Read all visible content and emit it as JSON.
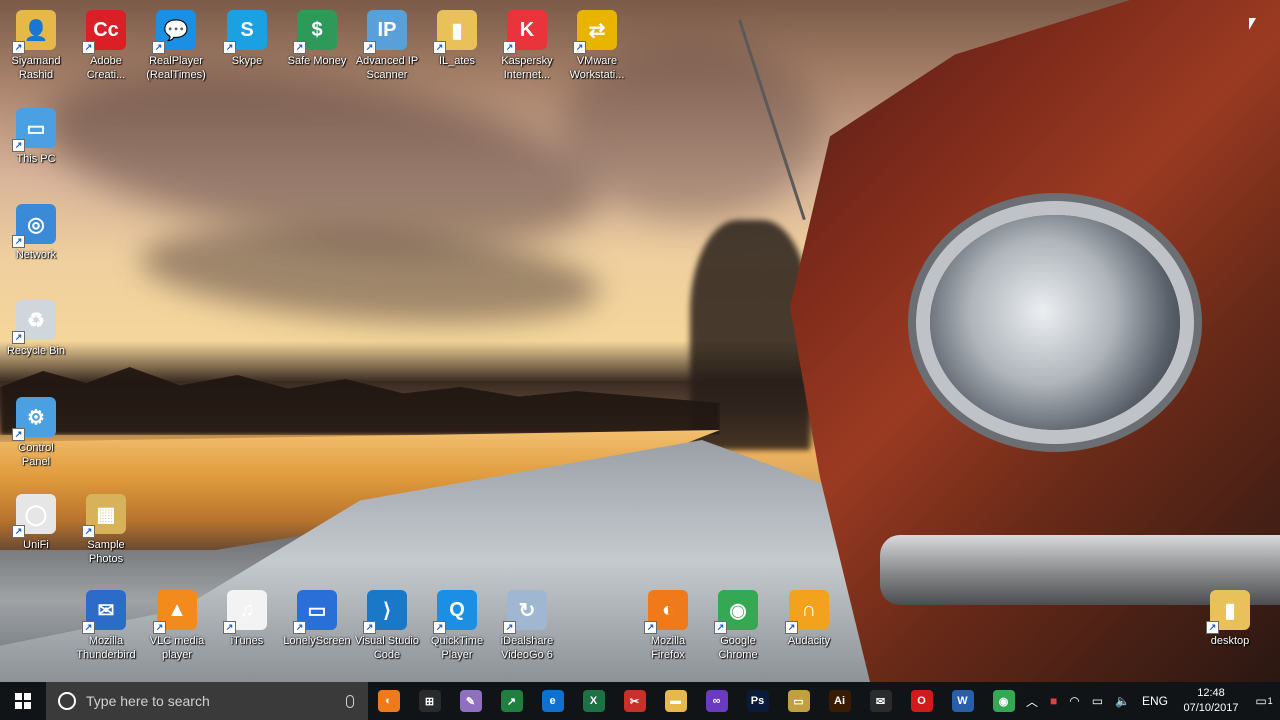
{
  "desktop_icons": [
    {
      "label": "Siyamand\nRashid",
      "icon": "user-folder-icon",
      "color": "#e6b84a",
      "glyph": "👤"
    },
    {
      "label": "Adobe\nCreati...",
      "icon": "adobe-cc-icon",
      "color": "#da1f26",
      "glyph": "Cc"
    },
    {
      "label": "RealPlayer\n(RealTimes)",
      "icon": "realplayer-icon",
      "color": "#1a8fe3",
      "glyph": "💬"
    },
    {
      "label": "Skype",
      "icon": "skype-icon",
      "color": "#1ba1e2",
      "glyph": "S"
    },
    {
      "label": "Safe Money",
      "icon": "safe-money-icon",
      "color": "#2d9a5a",
      "glyph": "$"
    },
    {
      "label": "Advanced IP\nScanner",
      "icon": "ip-scanner-icon",
      "color": "#5aa0d8",
      "glyph": "IP"
    },
    {
      "label": "IL_ates",
      "icon": "folder-icon",
      "color": "#e8c15a",
      "glyph": "▮"
    },
    {
      "label": "Kaspersky\nInternet...",
      "icon": "kaspersky-icon",
      "color": "#e8343a",
      "glyph": "K"
    },
    {
      "label": "VMware\nWorkstati...",
      "icon": "vmware-icon",
      "color": "#e8b400",
      "glyph": "⇄"
    },
    {
      "label": "This PC",
      "icon": "this-pc-icon",
      "color": "#4aa0e0",
      "glyph": "▭"
    },
    {
      "label": "Network",
      "icon": "network-icon",
      "color": "#3b8ad8",
      "glyph": "◎"
    },
    {
      "label": "Recycle Bin",
      "icon": "recycle-bin-icon",
      "color": "#cfd6dc",
      "glyph": "♻"
    },
    {
      "label": "Control\nPanel",
      "icon": "control-panel-icon",
      "color": "#4aa0e0",
      "glyph": "⚙"
    },
    {
      "label": "UniFi",
      "icon": "unifi-icon",
      "color": "#e6e6e6",
      "glyph": "◯"
    },
    {
      "label": "Sample\nPhotos",
      "icon": "photos-folder-icon",
      "color": "#d8b25a",
      "glyph": "▦"
    },
    {
      "label": "Mozilla\nThunderbird",
      "icon": "thunderbird-icon",
      "color": "#2c6bc8",
      "glyph": "✉"
    },
    {
      "label": "VLC media\nplayer",
      "icon": "vlc-icon",
      "color": "#f28a1c",
      "glyph": "▲"
    },
    {
      "label": "iTunes",
      "icon": "itunes-icon",
      "color": "#f3f3f3",
      "glyph": "♫"
    },
    {
      "label": "LonelyScreen",
      "icon": "lonelyscreen-icon",
      "color": "#2a6fd8",
      "glyph": "▭"
    },
    {
      "label": "Visual Studio\nCode",
      "icon": "vscode-icon",
      "color": "#1a78c8",
      "glyph": "⟩"
    },
    {
      "label": "QuickTime\nPlayer",
      "icon": "quicktime-icon",
      "color": "#1a8fe3",
      "glyph": "Q"
    },
    {
      "label": "iDealshare\nVideoGo 6",
      "icon": "idealshare-icon",
      "color": "#9fb7d0",
      "glyph": "↻"
    },
    {
      "label": "Mozilla\nFirefox",
      "icon": "firefox-icon",
      "color": "#f07a1a",
      "glyph": "◐"
    },
    {
      "label": "Google\nChrome",
      "icon": "chrome-icon",
      "color": "#34a853",
      "glyph": "◉"
    },
    {
      "label": "Audacity",
      "icon": "audacity-icon",
      "color": "#f2a21c",
      "glyph": "∩"
    },
    {
      "label": "desktop",
      "icon": "folder-icon",
      "color": "#e8c15a",
      "glyph": "▮"
    }
  ],
  "taskbar": {
    "search_placeholder": "Type here to search",
    "apps": [
      {
        "name": "firefox",
        "color": "#f07a1a",
        "glyph": "◐"
      },
      {
        "name": "store",
        "color": "#2b2b2b",
        "glyph": "⊞"
      },
      {
        "name": "paint",
        "color": "#8f6fbf",
        "glyph": "✎"
      },
      {
        "name": "green-app",
        "color": "#1e7f3e",
        "glyph": "↗"
      },
      {
        "name": "edge",
        "color": "#1070d0",
        "glyph": "e"
      },
      {
        "name": "excel",
        "color": "#1e7145",
        "glyph": "X"
      },
      {
        "name": "snip-tool",
        "color": "#c8302a",
        "glyph": "✂"
      },
      {
        "name": "file-explorer",
        "color": "#e8b84a",
        "glyph": "▬"
      },
      {
        "name": "visual-studio",
        "color": "#6a3bbf",
        "glyph": "∞"
      },
      {
        "name": "photoshop",
        "color": "#0a1a3a",
        "glyph": "Ps"
      },
      {
        "name": "folder-tool",
        "color": "#c0a040",
        "glyph": "▭"
      },
      {
        "name": "illustrator",
        "color": "#3a1c04",
        "glyph": "Ai"
      },
      {
        "name": "mail",
        "color": "#2b2b2b",
        "glyph": "✉"
      },
      {
        "name": "opera",
        "color": "#d11b1b",
        "glyph": "O"
      },
      {
        "name": "word",
        "color": "#2b5ea8",
        "glyph": "W"
      },
      {
        "name": "chrome",
        "color": "#34a853",
        "glyph": "◉"
      }
    ],
    "language": "ENG",
    "time": "12:48",
    "date": "07/10/2017",
    "notification_count": "1"
  }
}
